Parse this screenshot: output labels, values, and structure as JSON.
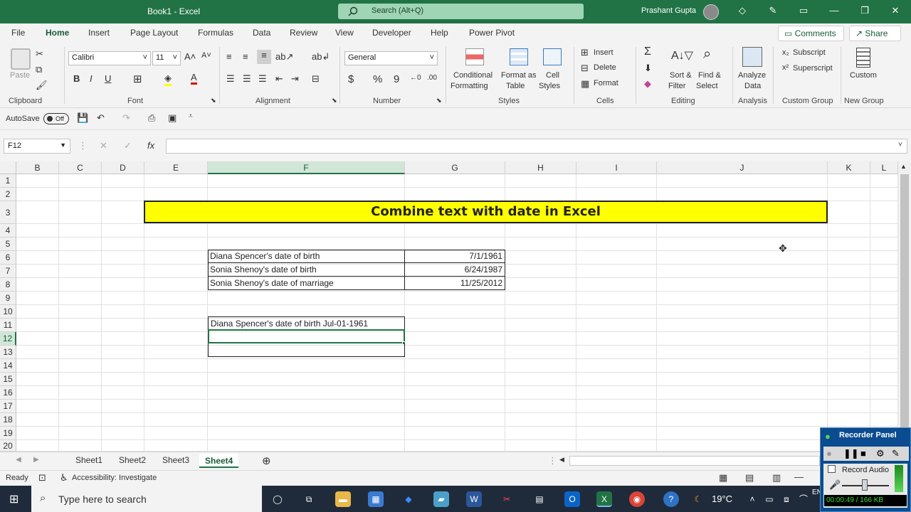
{
  "titlebar": {
    "title": "Book1  -  Excel",
    "search_placeholder": "Search (Alt+Q)",
    "user": "Prashant Gupta"
  },
  "ribbon_tabs": [
    "File",
    "Home",
    "Insert",
    "Page Layout",
    "Formulas",
    "Data",
    "Review",
    "View",
    "Developer",
    "Help",
    "Power Pivot"
  ],
  "active_tab": "Home",
  "header_buttons": {
    "comments": "Comments",
    "share": "Share"
  },
  "ribbon": {
    "clipboard": {
      "paste": "Paste",
      "label": "Clipboard"
    },
    "font": {
      "name": "Calibri",
      "size": "11",
      "label": "Font"
    },
    "alignment": {
      "label": "Alignment"
    },
    "number": {
      "format": "General",
      "label": "Number"
    },
    "styles": {
      "conditional": "Conditional",
      "conditional2": "Formatting",
      "format_as": "Format as",
      "format_as2": "Table",
      "cell": "Cell",
      "cell2": "Styles",
      "label": "Styles"
    },
    "cells": {
      "insert": "Insert",
      "delete": "Delete",
      "format": "Format",
      "label": "Cells"
    },
    "editing": {
      "sort": "Sort &",
      "sort2": "Filter",
      "find": "Find &",
      "find2": "Select",
      "label": "Editing"
    },
    "analysis": {
      "analyze": "Analyze",
      "analyze2": "Data",
      "label": "Analysis"
    },
    "custom_group": {
      "subscript": "Subscript",
      "superscript": "Superscript",
      "label": "Custom Group"
    },
    "new_group": {
      "custom": "Custom",
      "label": "New Group"
    }
  },
  "qat": {
    "autosave": "AutoSave",
    "toggle": "Off"
  },
  "formula_bar": {
    "name_box": "F12",
    "fx": "fx",
    "content": ""
  },
  "columns": [
    "B",
    "C",
    "D",
    "E",
    "F",
    "G",
    "H",
    "I",
    "J",
    "K",
    "L"
  ],
  "rows": [
    "1",
    "2",
    "3",
    "4",
    "5",
    "6",
    "7",
    "8",
    "9",
    "10",
    "11",
    "12",
    "13",
    "14",
    "15",
    "16",
    "17",
    "18",
    "19",
    "20"
  ],
  "cells": {
    "title": "Combine text with date in Excel",
    "f6": "Diana Spencer's date of birth",
    "g6": "7/1/1961",
    "f7": "Sonia Shenoy's date of birth",
    "g7": "6/24/1987",
    "f8": "Sonia Shenoy's date of marriage",
    "g8": "11/25/2012",
    "f11": "Diana Spencer's date of birth Jul-01-1961"
  },
  "sheets": [
    "Sheet1",
    "Sheet2",
    "Sheet3",
    "Sheet4"
  ],
  "active_sheet": "Sheet4",
  "status": {
    "ready": "Ready",
    "accessibility": "Accessibility: Investigate"
  },
  "taskbar": {
    "search_placeholder": "Type here to search",
    "temperature": "19°C",
    "lang": "EN"
  },
  "recorder": {
    "title": "Recorder Panel",
    "record_audio": "Record Audio",
    "time": "00:00:49 / 166 KB"
  },
  "colors": {
    "excel_green": "#217346",
    "title_fill": "#ffff00",
    "taskbar": "#1f2b3a"
  }
}
